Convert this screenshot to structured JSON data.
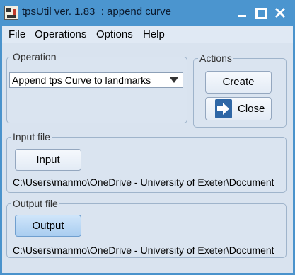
{
  "window": {
    "title": "tpsUtil ver. 1.83  : append curve"
  },
  "menu": {
    "items": [
      "File",
      "Operations",
      "Options",
      "Help"
    ]
  },
  "operation": {
    "legend": "Operation",
    "selected": "Append tps Curve to landmarks"
  },
  "actions": {
    "legend": "Actions",
    "create_label": "Create",
    "close_label": "Close"
  },
  "input_file": {
    "legend": "Input file",
    "button_label": "Input",
    "path": "C:\\Users\\manmo\\OneDrive - University of Exeter\\Document"
  },
  "output_file": {
    "legend": "Output file",
    "button_label": "Output",
    "path": "C:\\Users\\manmo\\OneDrive - University of Exeter\\Document"
  },
  "colors": {
    "titlebar": "#4b95cf",
    "client": "#d9e3ef",
    "close_icon": "#2f67a6"
  },
  "icons": {
    "app": "tps-app-icon",
    "close": "exit-arrow-icon",
    "dropdown": "chevron-down-icon"
  }
}
